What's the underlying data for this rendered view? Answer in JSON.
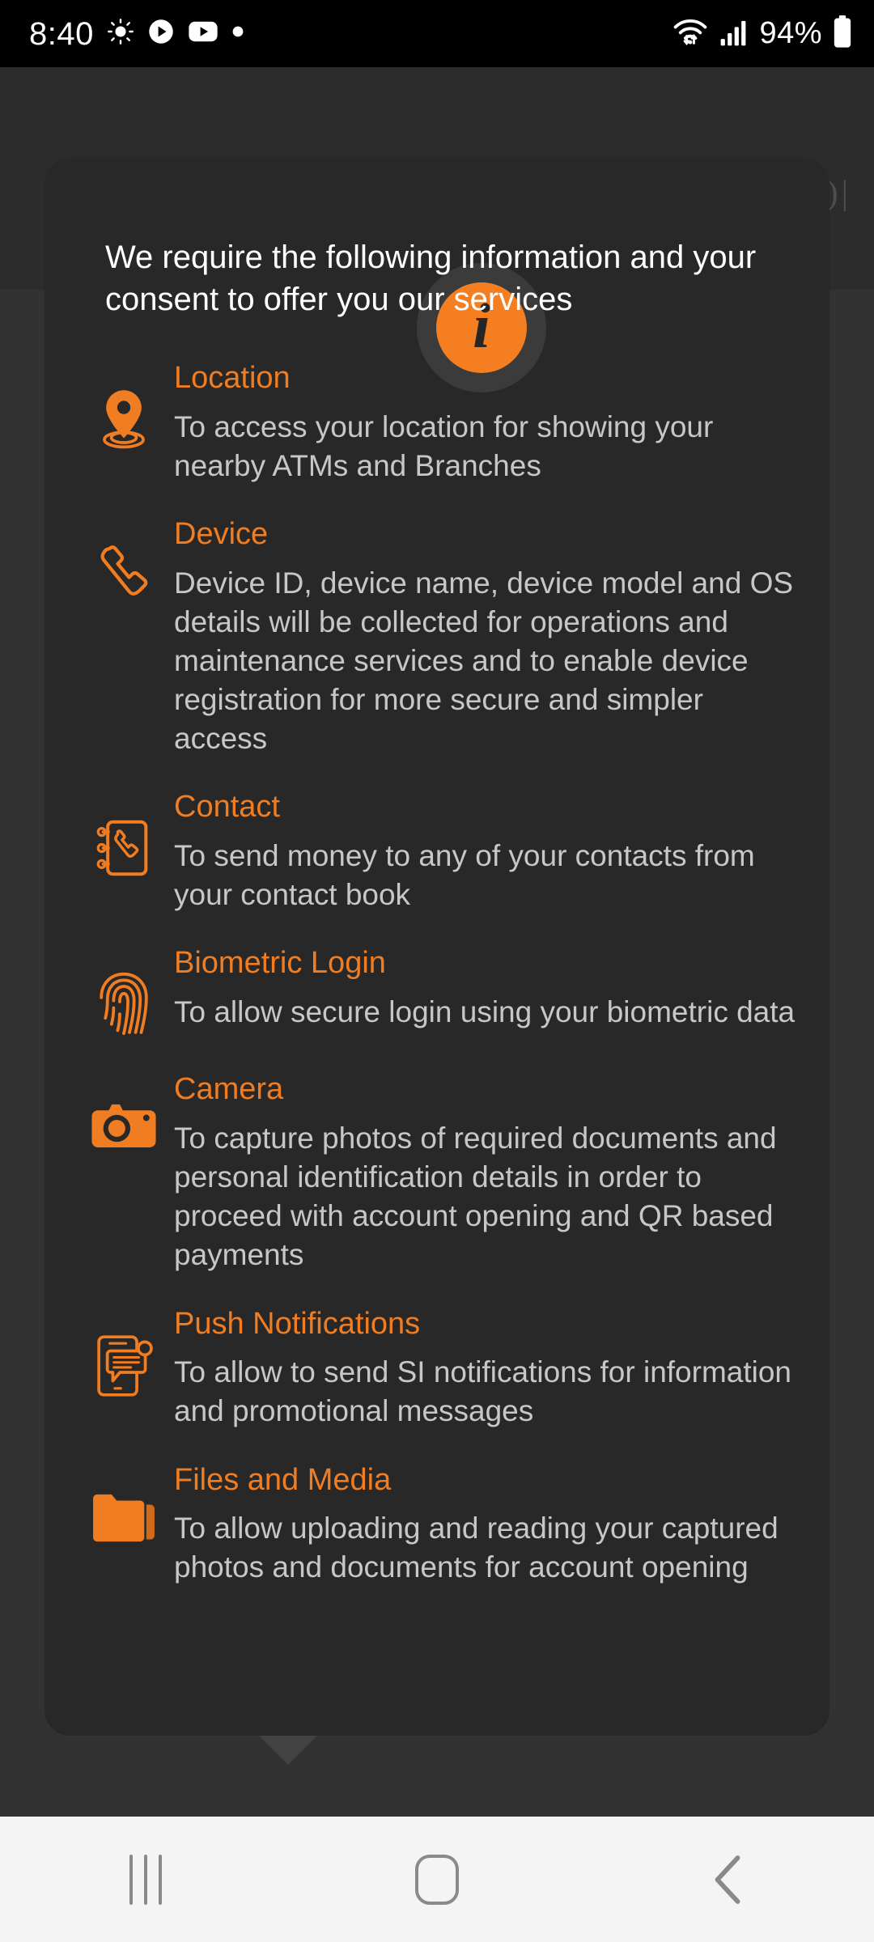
{
  "status_bar": {
    "time": "8:40",
    "battery_percent": "94%",
    "left_icons": [
      "brightness-icon",
      "play-circle-icon",
      "youtube-icon",
      "dot-indicator-icon"
    ],
    "right_icons": [
      "wifi-icon",
      "cellular-signal-icon",
      "battery-icon"
    ]
  },
  "background": {
    "ghost_text": ")|"
  },
  "dialog": {
    "info_icon_glyph": "i",
    "header": "We require the following information and your consent to offer you our services",
    "items": [
      {
        "icon": "location-pin-icon",
        "title": "Location",
        "description": "To access your location for showing your nearby ATMs and Branches"
      },
      {
        "icon": "phone-handset-icon",
        "title": "Device",
        "description": "Device ID, device name, device model and OS details will be collected for operations and maintenance services and to enable device registration for more secure and simpler access"
      },
      {
        "icon": "contact-book-icon",
        "title": "Contact",
        "description": "To send money to any of your contacts from your contact book"
      },
      {
        "icon": "fingerprint-icon",
        "title": "Biometric Login",
        "description": "To allow secure login using your biometric data"
      },
      {
        "icon": "camera-icon",
        "title": "Camera",
        "description": "To capture photos of required documents and personal identification details in order to proceed with account opening and QR based payments"
      },
      {
        "icon": "push-notification-icon",
        "title": "Push Notifications",
        "description": "To allow to send SI notifications for information and promotional messages"
      },
      {
        "icon": "folder-icon",
        "title": "Files and Media",
        "description": "To allow uploading and reading your captured photos and documents for account opening"
      }
    ]
  },
  "nav_bar": {
    "recents_label": "recents-button",
    "home_label": "home-button",
    "back_label": "back-button"
  },
  "colors": {
    "accent": "#f07d22",
    "dialog_bg": "#282828",
    "page_bg": "#3a3a3a",
    "desc_text": "#c7c7c7",
    "nav_bg": "#f4f4f4"
  }
}
